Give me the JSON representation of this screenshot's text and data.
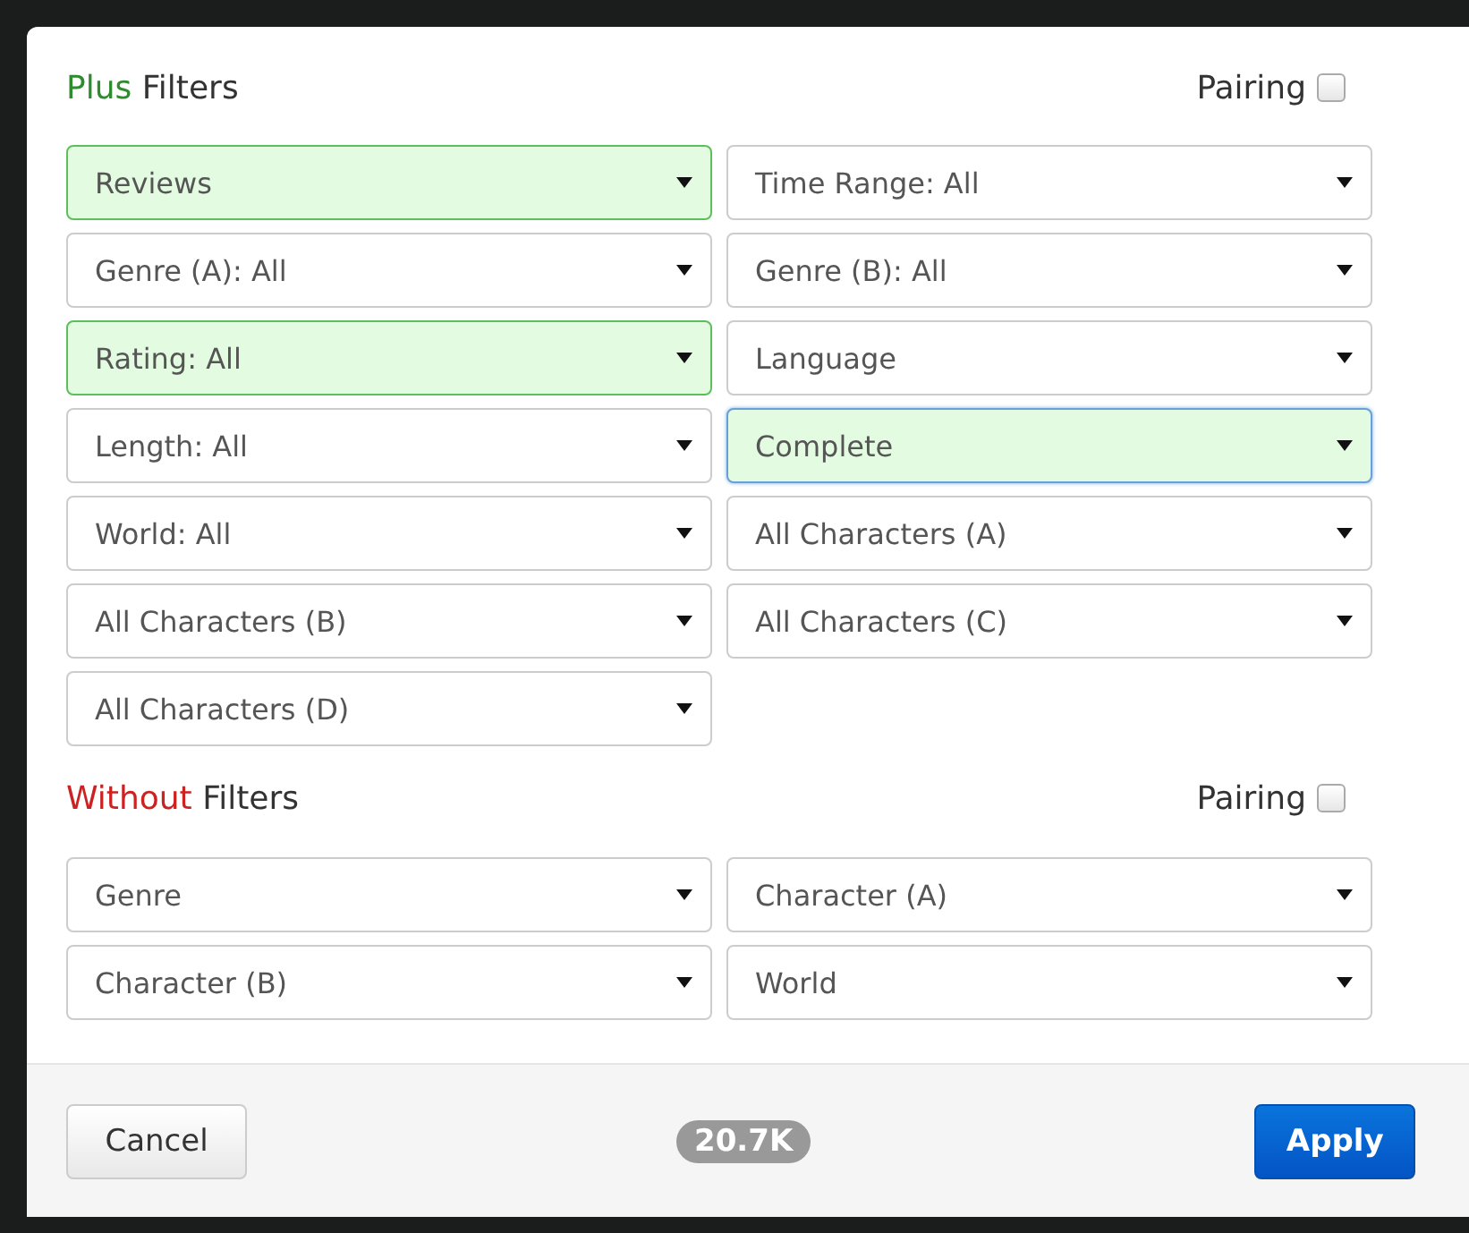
{
  "sections": [
    {
      "accent": "Plus",
      "color": "#2e8b2e",
      "title": "Filters",
      "pairing": {
        "label": "Pairing",
        "checked": false
      },
      "selects": [
        {
          "label": "Reviews",
          "active": true,
          "focused": false
        },
        {
          "label": "Time Range: All",
          "active": false,
          "focused": false
        },
        {
          "label": "Genre (A): All",
          "active": false,
          "focused": false
        },
        {
          "label": "Genre (B): All",
          "active": false,
          "focused": false
        },
        {
          "label": "Rating: All",
          "active": true,
          "focused": false
        },
        {
          "label": "Language",
          "active": false,
          "focused": false
        },
        {
          "label": "Length: All",
          "active": false,
          "focused": false
        },
        {
          "label": "Complete",
          "active": true,
          "focused": true
        },
        {
          "label": "World: All",
          "active": false,
          "focused": false
        },
        {
          "label": "All Characters (A)",
          "active": false,
          "focused": false
        },
        {
          "label": "All Characters (B)",
          "active": false,
          "focused": false
        },
        {
          "label": "All Characters (C)",
          "active": false,
          "focused": false
        },
        {
          "label": "All Characters (D)",
          "active": false,
          "focused": false
        }
      ]
    },
    {
      "accent": "Without",
      "color": "#cc2222",
      "title": "Filters",
      "pairing": {
        "label": "Pairing",
        "checked": false
      },
      "selects": [
        {
          "label": "Genre",
          "active": false,
          "focused": false
        },
        {
          "label": "Character (A)",
          "active": false,
          "focused": false
        },
        {
          "label": "Character (B)",
          "active": false,
          "focused": false
        },
        {
          "label": "World",
          "active": false,
          "focused": false
        }
      ]
    }
  ],
  "footer": {
    "cancel": "Cancel",
    "count": "20.7K",
    "apply": "Apply"
  }
}
